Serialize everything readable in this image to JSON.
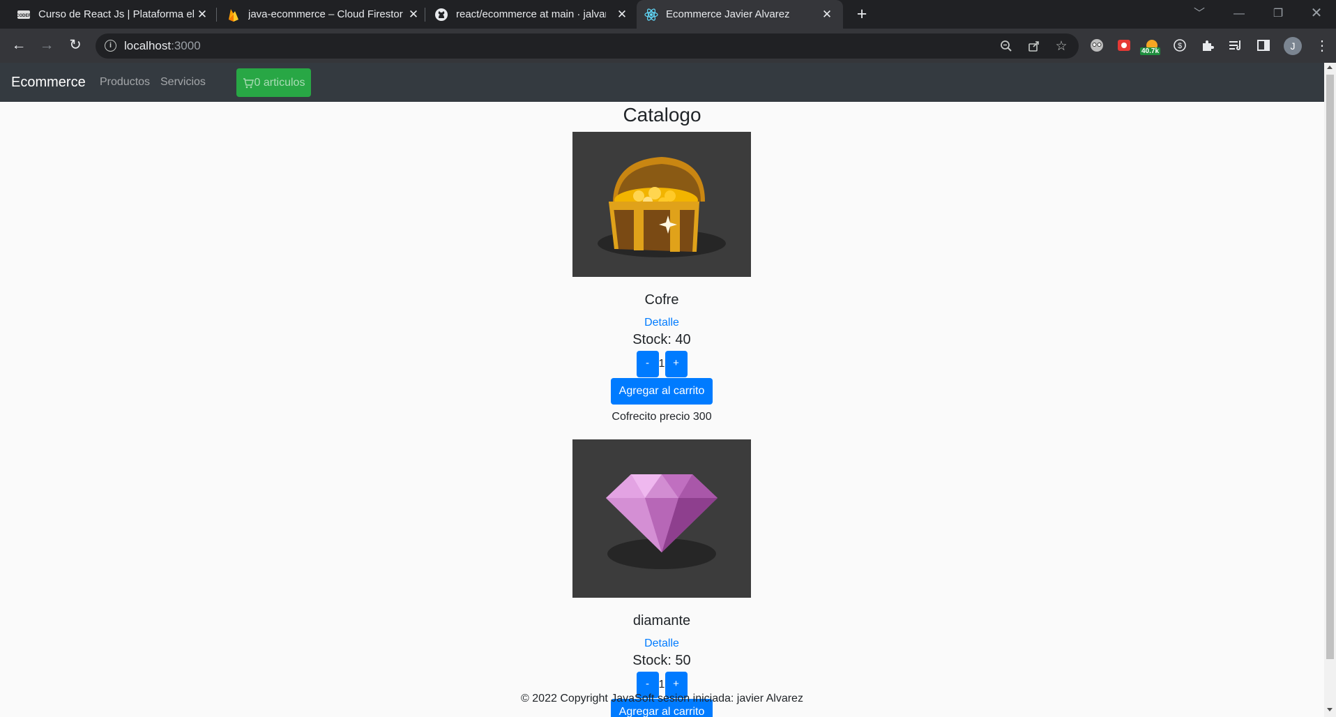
{
  "browser": {
    "tabs": [
      {
        "title": "Curso de React Js | Plataforma el",
        "icon": "codehouse-icon",
        "active": false
      },
      {
        "title": "java-ecommerce – Cloud Firestor",
        "icon": "firebase-icon",
        "active": false
      },
      {
        "title": "react/ecommerce at main · jalvar",
        "icon": "github-icon",
        "active": false
      },
      {
        "title": "Ecommerce Javier Alvarez",
        "icon": "react-icon",
        "active": true
      }
    ],
    "url_host": "localhost",
    "url_port": ":3000",
    "badge_count": "40.7k",
    "profile_initial": "J"
  },
  "navbar": {
    "brand": "Ecommerce",
    "links": [
      "Productos",
      "Servicios"
    ],
    "cart_label": "0 articulos"
  },
  "catalog": {
    "title": "Catalogo",
    "products": [
      {
        "name": "Cofre",
        "detail_label": "Detalle",
        "stock_label": "Stock: 40",
        "quantity": "1",
        "minus": "-",
        "plus": "+",
        "add_label": "Agregar al carrito",
        "description": "Cofrecito precio 300",
        "image": "treasure-chest"
      },
      {
        "name": "diamante",
        "detail_label": "Detalle",
        "stock_label": "Stock: 50",
        "quantity": "1",
        "minus": "-",
        "plus": "+",
        "add_label": "Agregar al carrito",
        "description": "",
        "image": "diamond"
      }
    ]
  },
  "footer": {
    "text": "© 2022 Copyright JavaSoft sesion iniciada: javier Alvarez"
  },
  "colors": {
    "navbar_bg": "#343a40",
    "cart_button": "#28a745",
    "primary_button": "#007bff"
  }
}
